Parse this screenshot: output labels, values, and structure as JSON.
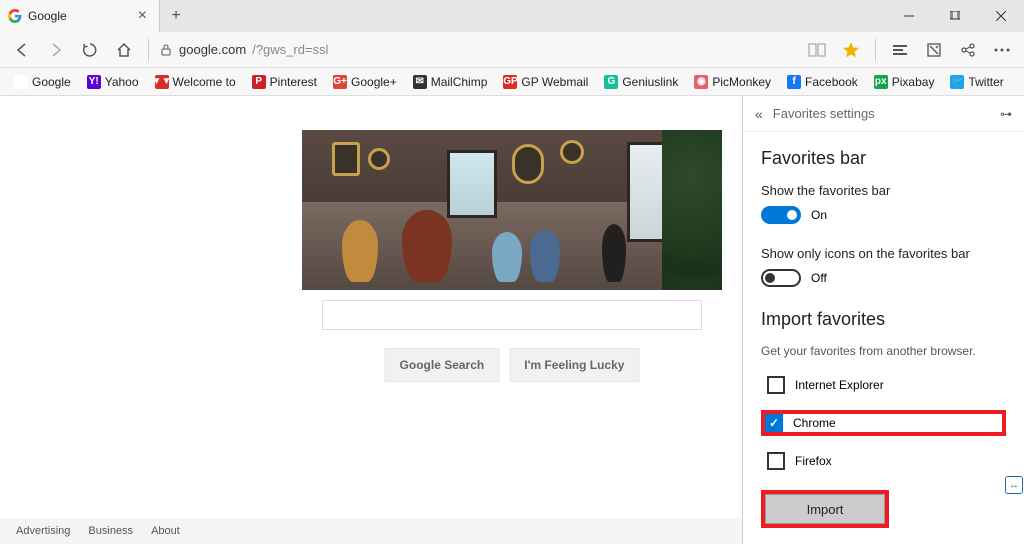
{
  "tab": {
    "title": "Google",
    "favicon": "G"
  },
  "addressbar": {
    "domain": "google.com",
    "path": "/?gws_rd=ssl"
  },
  "favorites_bar": [
    {
      "icon": "G",
      "color": "#fff",
      "label": "Google"
    },
    {
      "icon": "Y!",
      "color": "#5f00d6",
      "label": "Yahoo"
    },
    {
      "icon": "▼▼",
      "color": "#d92d2a",
      "label": "Welcome to"
    },
    {
      "icon": "P",
      "color": "#c8232c",
      "label": "Pinterest"
    },
    {
      "icon": "G+",
      "color": "#db4437",
      "label": "Google+"
    },
    {
      "icon": "✉",
      "color": "#333",
      "label": "MailChimp"
    },
    {
      "icon": "GP",
      "color": "#d92d2a",
      "label": "GP Webmail"
    },
    {
      "icon": "G",
      "color": "#1abc9c",
      "label": "Geniuslink"
    },
    {
      "icon": "◉",
      "color": "#e2636e",
      "label": "PicMonkey"
    },
    {
      "icon": "f",
      "color": "#1877f2",
      "label": "Facebook"
    },
    {
      "icon": "px",
      "color": "#10a64a",
      "label": "Pixabay"
    },
    {
      "icon": "🐦",
      "color": "#1da1f2",
      "label": "Twitter"
    }
  ],
  "google": {
    "search_btn": "Google Search",
    "lucky_btn": "I'm Feeling Lucky"
  },
  "footer": [
    "Advertising",
    "Business",
    "About"
  ],
  "panel": {
    "title": "Favorites settings",
    "section_bar": "Favorites bar",
    "show_bar_label": "Show the favorites bar",
    "show_bar_state": "On",
    "icons_only_label": "Show only icons on the favorites bar",
    "icons_only_state": "Off",
    "import_title": "Import favorites",
    "import_sub": "Get your favorites from another browser.",
    "browsers": [
      {
        "name": "Internet Explorer",
        "checked": false,
        "highlight": false
      },
      {
        "name": "Chrome",
        "checked": true,
        "highlight": true
      },
      {
        "name": "Firefox",
        "checked": false,
        "highlight": false
      }
    ],
    "import_btn": "Import"
  }
}
